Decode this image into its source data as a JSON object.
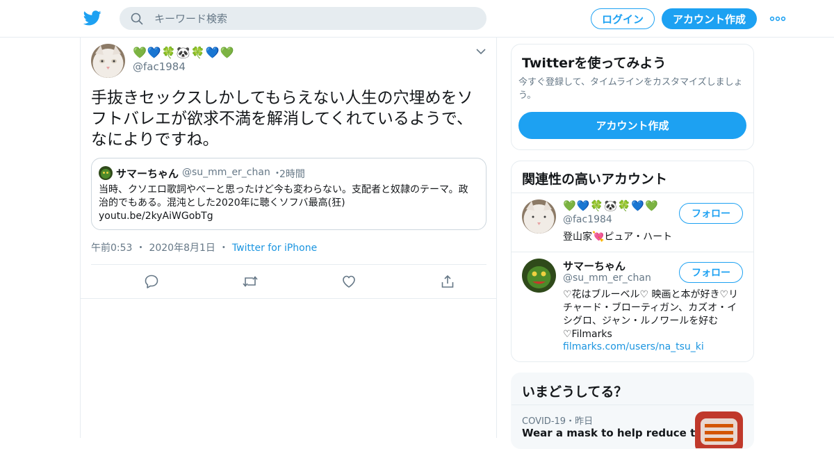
{
  "header": {
    "search_placeholder": "キーワード検索",
    "login_label": "ログイン",
    "signup_label": "アカウント作成"
  },
  "tweet": {
    "display_name": "💚💙🍀🐼🍀💙💚",
    "handle": "@fac1984",
    "text": "手抜きセックスしかしてもらえない人生の穴埋めをソフトバレエが欲求不満を解消してくれているようで、なによりですね。",
    "quote": {
      "name": "サマーちゃん",
      "handle": "@su_mm_er_chan",
      "dot": "・",
      "time": "2時間",
      "text_line1": "当時、クソエロ歌詞やべーと思ったけど今も変わらない。支配者と奴隷のテーマ。政治的でもある。混沌とした2020年に聴くソフバ最高(狂)",
      "link": "youtu.be/2kyAiWGobTg"
    },
    "time": "午前0:53",
    "date": "2020年8月1日",
    "source": "Twitter for iPhone",
    "sep": "・"
  },
  "sidebar": {
    "try": {
      "title": "Twitterを使ってみよう",
      "desc": "今すぐ登録して、タイムラインをカスタマイズしましょう。",
      "button": "アカウント作成"
    },
    "related": {
      "title": "関連性の高いアカウント",
      "accounts": [
        {
          "name": "💚💙🍀🐼🍀💙💚",
          "handle": "@fac1984",
          "bio": "登山家💘ピュア・ハート",
          "follow": "フォロー"
        },
        {
          "name": "サマーちゃん",
          "handle": "@su_mm_er_chan",
          "bio": "♡花はブルーベル♡ 映画と本が好き♡リチャード・ブローティガン、カズオ・イシグロ、ジャン・ルノワールを好む♡Filmarks",
          "link": "filmarks.com/users/na_tsu_ki",
          "follow": "フォロー"
        }
      ]
    },
    "trends": {
      "title": "いまどうしてる？",
      "category": "COVID-19",
      "sep": "・",
      "time": "昨日",
      "headline": "Wear a mask to help reduce the"
    }
  },
  "colors": {
    "brand": "#1da1f2",
    "link": "#1b95e0",
    "muted": "#657786"
  }
}
